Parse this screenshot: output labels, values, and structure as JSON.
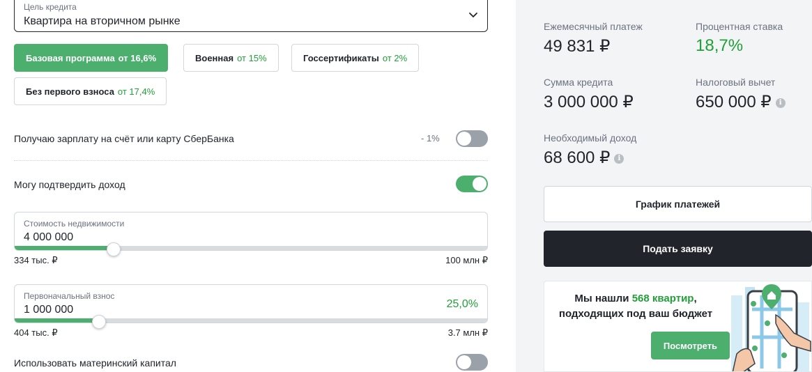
{
  "purpose": {
    "label": "Цель кредита",
    "value": "Квартира на вторичном рынке"
  },
  "programs": [
    {
      "name": "Базовая программа",
      "rate": "от 16,6%",
      "active": true
    },
    {
      "name": "Военная",
      "rate": "от 15%",
      "active": false
    },
    {
      "name": "Госсертификаты",
      "rate": "от 2%",
      "active": false
    },
    {
      "name": "Без первого взноса",
      "rate": "от 17,4%",
      "active": false
    }
  ],
  "salary_option": {
    "label": "Получаю зарплату на счёт или карту СберБанка",
    "discount": "- 1%",
    "enabled": false
  },
  "income_option": {
    "label": "Могу подтвердить доход",
    "enabled": true
  },
  "property_cost": {
    "label": "Стоимость недвижимости",
    "value": "4 000 000",
    "min": "334 тыс. ₽",
    "max": "100 млн ₽",
    "slider_fraction": 0.21
  },
  "down_payment": {
    "label": "Первоначальный взнос",
    "value": "1 000 000",
    "percent": "25,0%",
    "min": "404 тыс. ₽",
    "max": "3.7 млн ₽",
    "slider_fraction": 0.18
  },
  "maternity_capital": {
    "label": "Использовать материнский капитал",
    "enabled": false
  },
  "results": {
    "monthly_payment_label": "Ежемесячный платеж",
    "monthly_payment": "49 831 ₽",
    "rate_label": "Процентная ставка",
    "rate": "18,7%",
    "loan_amount_label": "Сумма кредита",
    "loan_amount": "3 000 000 ₽",
    "tax_deduction_label": "Налоговый вычет",
    "tax_deduction": "650 000 ₽",
    "required_income_label": "Необходимый доход",
    "required_income": "68 600 ₽",
    "info_glyph": "i"
  },
  "actions": {
    "schedule": "График платежей",
    "apply": "Подать заявку"
  },
  "promo": {
    "text_before": "Мы нашли",
    "highlight": "568 квартир",
    "text_after": ",",
    "line2": "подходящих под ваш бюджет",
    "button": "Посмотреть"
  },
  "colors": {
    "accent": "#21a038",
    "accent_button": "#4caf6e",
    "dark_button": "#21252b",
    "right_panel_bg": "#f2f4f5"
  },
  "icons": {
    "select": "chevron-down-icon",
    "info": "info-icon",
    "promo": "map-phone-illustration"
  }
}
